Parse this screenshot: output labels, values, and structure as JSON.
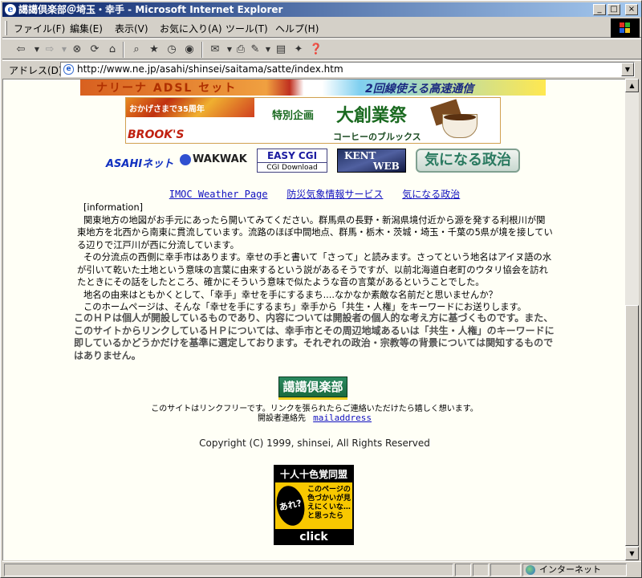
{
  "window": {
    "title": "譪譪倶楽部＠埼玉・幸手 - Microsoft Internet Explorer"
  },
  "menubar": {
    "items": [
      "ファイル(F)",
      "編集(E)",
      "表示(V)",
      "お気に入り(A)",
      "ツール(T)",
      "ヘルプ(H)"
    ]
  },
  "toolbar": {
    "buttons": [
      "back-icon",
      "forward-icon",
      "stop-icon",
      "refresh-icon",
      "home-icon",
      "search-icon",
      "favorites-icon",
      "history-icon",
      "mail-icon",
      "print-icon",
      "edit-icon",
      "discuss-icon",
      "messenger-icon"
    ]
  },
  "address": {
    "label": "アドレス(D)",
    "url": "http://www.ne.jp/asahi/shinsei/saitama/satte/index.htm"
  },
  "page": {
    "banner_top_left": "ナリーナ ADSL セット",
    "banner_top_right": "2回線使える高速通信",
    "brooks": {
      "anniv": "おかげさまで35周年",
      "special": "特別企画",
      "big": "大創業祭",
      "logo": "BROOK'S",
      "coffee": "コーヒーのブルックス"
    },
    "link_banners": {
      "asahi": "ASAHIネット",
      "wakwak": "WAKWAK",
      "easycgi_title": "EASY CGI",
      "easycgi_sub": "CGI Download",
      "kent_1": "KENT",
      "kent_2": "WEB",
      "kininaru": "気になる政治"
    },
    "nav_links": [
      "IMOC Weather Page",
      "防災気象情報サービス",
      "気になる政治"
    ],
    "info_heading": "[information]",
    "info_paragraphs": [
      "関東地方の地図がお手元にあったら開いてみてください。群馬県の長野・新潟県境付近から源を発する利根川が関東地方を北西から南東に貫流しています。流路のほぼ中間地点、群馬・栃木・茨城・埼玉・千葉の5県が境を接している辺りで江戸川が西に分流しています。",
      "その分流点の西側に幸手市はあります。幸せの手と書いて「さって」と読みます。さってという地名はアイヌ語の水が引いて乾いた土地という意味の言葉に由来するという説があるそうですが、以前北海道白老町のウタリ協会を訪れたときにその話をしたところ、確かにそういう意味で似たような音の言葉があるということでした。",
      "地名の由来はともかくとして、「幸手」幸せを手にするまち....なかなか素敵な名前だと思いませんか？",
      "このホームページは、そんな「幸せを手にするまち」幸手から「共生・人権」をキーワードにお送りします。"
    ],
    "notice": "このＨＰは個人が開設しているものであり、内容については開設者の個人的な考え方に基づくものです。また、このサイトからリンクしているＨＰについては、幸手市とその周辺地域あるいは「共生・人権」のキーワードに即しているかどうかだけを基準に選定しております。それぞれの政治・宗教等の背景については関知するものではありません。",
    "club_logo": "譪譪倶楽部",
    "linkfree": "このサイトはリンクフリーです。リンクを張られたらご連絡いただけたら嬉しく想います。",
    "contact_label": "開設者連絡先",
    "contact_link": "mailaddress",
    "copyright": "Copyright (C) 1999, shinsei, All Rights Reserved",
    "badge": {
      "head": "十人十色覚同盟",
      "bubble": "あれ?",
      "text": "このページの色づかいが見えにくいな…と思ったら",
      "click": "click"
    }
  },
  "status": {
    "zone": "インターネット"
  }
}
